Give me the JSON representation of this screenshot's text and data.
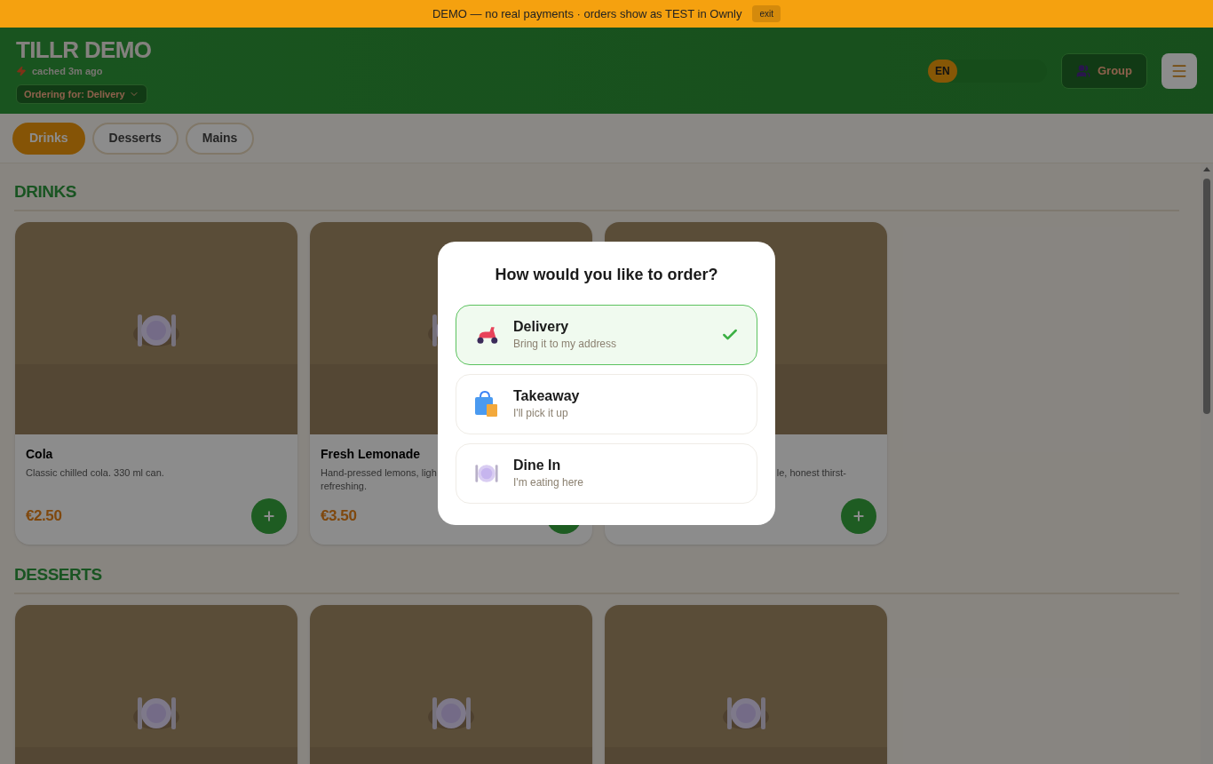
{
  "demo_banner": {
    "text": "DEMO — no real payments · orders show as TEST in Ownly",
    "exit_button": "exit"
  },
  "header": {
    "title": "TILLR DEMO",
    "cache_status": "cached 3m ago",
    "order_mode_button": "Ordering for: Delivery",
    "languages": [
      {
        "label": "EN",
        "selected": true
      }
    ],
    "group_button": "Group"
  },
  "category_tabs": [
    {
      "label": "Drinks",
      "selected": true
    },
    {
      "label": "Desserts",
      "selected": false
    },
    {
      "label": "Mains",
      "selected": false
    }
  ],
  "sections": [
    {
      "title": "DRINKS",
      "items": [
        {
          "image": {
            "kind": "picture"
          },
          "name": "Cola",
          "description_lines": [
            {
              "kind": "full",
              "text": "Classic chilled cola. 330 ml can."
            }
          ],
          "price": "€2.50"
        },
        {
          "image": {
            "kind": "picture"
          },
          "name": "Fresh Lemonade",
          "description_lines": [
            {
              "kind": "full",
              "text": "Hand-pressed lemons, ligh"
            },
            {
              "kind": "full",
              "text": "refreshing."
            }
          ],
          "price": "€3.50"
        },
        {
          "image": {
            "kind": "picture"
          },
          "description_lines": [
            {
              "kind": "tail",
              "text": "le, honest thirst-"
            }
          ]
        }
      ]
    },
    {
      "title": "DESSERTS",
      "items": [
        {
          "image": {
            "kind": "picture"
          }
        },
        {
          "image": {
            "kind": "picture"
          }
        },
        {
          "image": {
            "kind": "picture"
          }
        }
      ]
    }
  ],
  "order_dialog": {
    "title": "How would you like to order?",
    "options": [
      {
        "kind": "delivery",
        "label": "Delivery",
        "hint": "Bring it to my address",
        "selected": true
      },
      {
        "kind": "takeaway",
        "label": "Takeaway",
        "hint": "I'll pick it up",
        "selected": false
      },
      {
        "kind": "dine_in",
        "label": "Dine In",
        "hint": "I'm eating here",
        "selected": false
      }
    ]
  }
}
